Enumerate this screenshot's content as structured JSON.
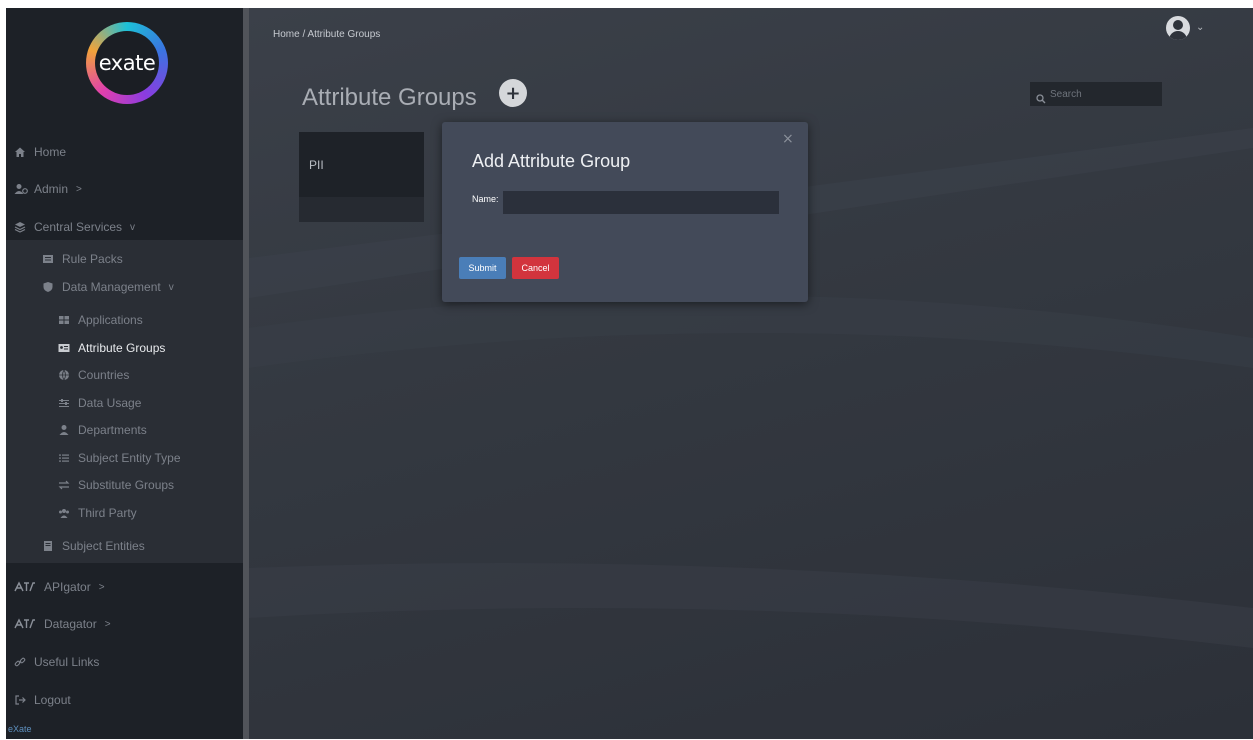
{
  "brand": {
    "logo_text": "exate"
  },
  "sidebar": {
    "items": [
      {
        "label": "Home",
        "icon": "home-icon",
        "arrow": ""
      },
      {
        "label": "Admin",
        "icon": "users-icon",
        "arrow": ">"
      },
      {
        "label": "Central Services",
        "icon": "layers-icon",
        "arrow": "v"
      },
      {
        "label": "Rule Packs",
        "icon": "rule-packs-icon",
        "arrow": ""
      },
      {
        "label": "Data Management",
        "icon": "shield-icon",
        "arrow": "v"
      },
      {
        "label": "Applications",
        "icon": "grid-icon",
        "arrow": ""
      },
      {
        "label": "Attribute Groups",
        "icon": "id-card-icon",
        "arrow": ""
      },
      {
        "label": "Countries",
        "icon": "globe-icon",
        "arrow": ""
      },
      {
        "label": "Data Usage",
        "icon": "sliders-icon",
        "arrow": ""
      },
      {
        "label": "Departments",
        "icon": "user-icon",
        "arrow": ""
      },
      {
        "label": "Subject Entity Type",
        "icon": "list-icon",
        "arrow": ""
      },
      {
        "label": "Substitute Groups",
        "icon": "exchange-icon",
        "arrow": ""
      },
      {
        "label": "Third Party",
        "icon": "group-icon",
        "arrow": ""
      },
      {
        "label": "Subject Entities",
        "icon": "book-icon",
        "arrow": ""
      },
      {
        "label": "APIgator",
        "icon": "apigator-logo-icon",
        "arrow": ">"
      },
      {
        "label": "Datagator",
        "icon": "datagator-logo-icon",
        "arrow": ">"
      },
      {
        "label": "Useful Links",
        "icon": "link-icon",
        "arrow": ""
      },
      {
        "label": "Logout",
        "icon": "logout-icon",
        "arrow": ""
      }
    ],
    "footer": "eXate"
  },
  "header": {
    "breadcrumb": "Home /  Attribute Groups",
    "title": "Attribute Groups",
    "add_label": "+",
    "search_placeholder": "Search"
  },
  "cards": [
    {
      "label": "PII"
    }
  ],
  "modal": {
    "title": "Add Attribute Group",
    "close_label": "×",
    "name_label": "Name:",
    "name_value": "",
    "submit_label": "Submit",
    "cancel_label": "Cancel"
  },
  "colors": {
    "sidebar_bg": "#1d2127",
    "main_bg": "#343941",
    "modal_bg": "#434a59",
    "submit": "#4a7eb8",
    "cancel": "#d2343d",
    "link": "#5e8fbd"
  }
}
